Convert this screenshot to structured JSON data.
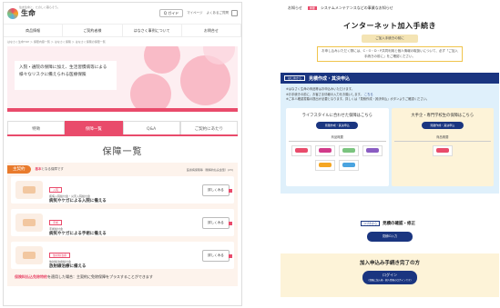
{
  "left": {
    "header": {
      "brand_sub": "住友生命と、たのしく暮らそう。",
      "brand": "生命",
      "search": "Q ガイド",
      "links": [
        "マイページ",
        "よくあるご質問"
      ]
    },
    "gnav": [
      "商品情報",
      "ご契約者様",
      "はなさく事例について",
      "お問合せ"
    ],
    "breadcrumb": "はなさく生命TOP ＞ 保障内容一覧 ＞ はなさく保険 ＞ はなさく保険の保障一覧",
    "hero_text": "入院・通院の保障に加え、生活習慣病等による様々なリスクに備えられる医療保険",
    "tabs": [
      "特徴",
      "保障一覧",
      "Q&A",
      "ご契約にあたり"
    ],
    "section_title": "保障一覧",
    "main_badge": "主契約",
    "main_note_bold": "基本",
    "main_note": "となる保障です",
    "count": "医療病保険等（無解約払戻金型）(23)",
    "cards": [
      {
        "tag": "入院",
        "name": "疾病入院給付金・災害入院給付金",
        "desc": "病気やケガによる入院に備える",
        "btn": "詳しくみる"
      },
      {
        "tag": "手術",
        "name": "手術給付金",
        "desc": "病気やケガによる手術に備える",
        "btn": "詳しくみる"
      },
      {
        "tag": "放射線治療",
        "name": "放射線治療給付金",
        "desc": "放射線治療に備える",
        "btn": "詳しくみる"
      }
    ],
    "foot_red": "保険料払込免除特約",
    "foot": "を適用した場合：主契約に免除保障をプラスすることができます"
  },
  "right": {
    "notice_label": "お知らせ",
    "notice_badge": "重要",
    "notice_text": "システムメンテナンスなどの事業なお知らせ",
    "title": "インターネット加入手続き",
    "label": "ご加入手続きの前に",
    "note": "お申し込みいただく際には、C・O・D・P共同利用と個人情報の取扱いについて、必ず「ご加入手続きの前に」をご確認ください。",
    "bar_tag": "はじめから",
    "bar_title": "見積作成・其決申込",
    "steps_text": [
      "※はなさく生命の商品等はお申込みいただけます。",
      "※お手続きの前に、お客さま情報の入力をお願いします。",
      "※ご本人確認書類の提出が必要となります。詳しくは「見積作成・其決申込」ボタンよりご確認ください。"
    ],
    "link_text": "こちら",
    "col1_title": "ライフスタイルに合わせた保障はこちら",
    "col1_btn": "見積作成・其決申込",
    "col2_title": "大手企・専門学校生の保障はこちら",
    "col2_btn": "見積作成・其決申込",
    "prod_label": "商品概要",
    "fix_tag": "つづきから",
    "fix_title": "見積の確認・修正",
    "fix_btn": "見積ID入力",
    "after_title": "加入申込み手続き完了の方",
    "login": "ログイン",
    "login_sub": "(保険に加入後・個人情報のログインです)"
  },
  "colors": {
    "accent": "#e94b6b",
    "navy": "#1a3580",
    "orange": "#e97a2b"
  }
}
